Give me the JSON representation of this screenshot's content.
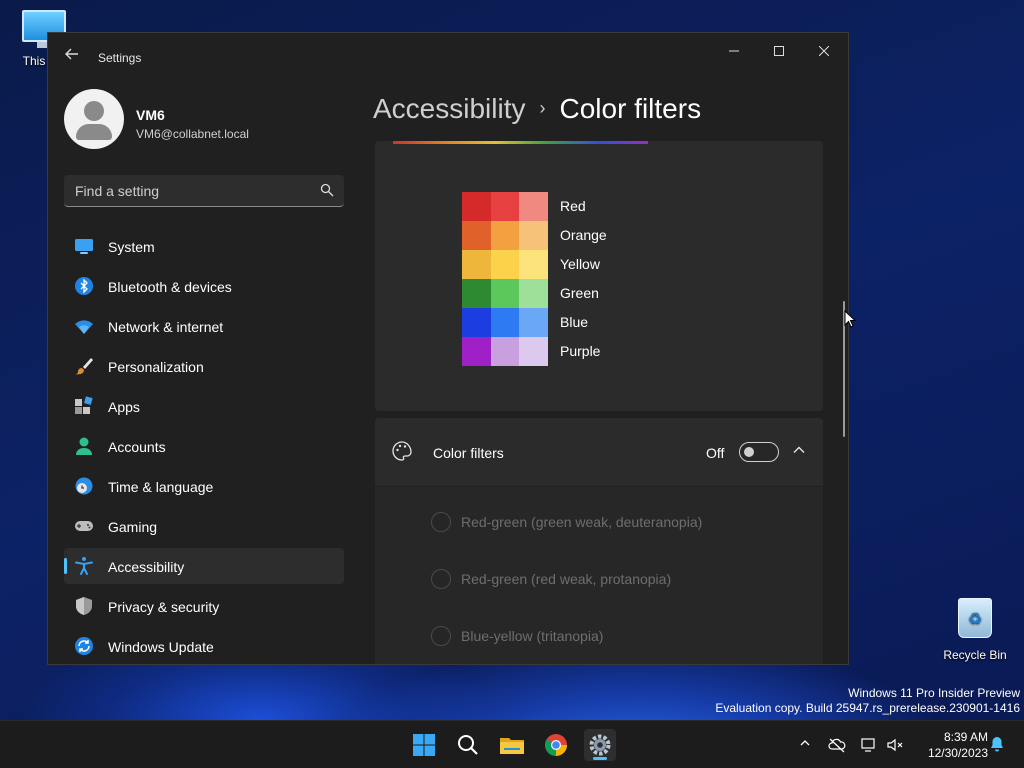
{
  "desktop": {
    "icons": [
      {
        "label": "This PC"
      },
      {
        "label": "Recycle Bin"
      }
    ],
    "watermark": {
      "line1": "Windows 11 Pro Insider Preview",
      "line2": "Evaluation copy. Build 25947.rs_prerelease.230901-1416"
    }
  },
  "window": {
    "app_title": "Settings",
    "controls": {
      "minimize": "–",
      "maximize": "□",
      "close": "✕"
    }
  },
  "profile": {
    "name": "VM6",
    "email": "VM6@collabnet.local"
  },
  "search": {
    "placeholder": "Find a setting"
  },
  "sidebar": {
    "items": [
      {
        "label": "System",
        "icon": "system-icon",
        "active": false
      },
      {
        "label": "Bluetooth & devices",
        "icon": "bluetooth-icon",
        "active": false
      },
      {
        "label": "Network & internet",
        "icon": "wifi-icon",
        "active": false
      },
      {
        "label": "Personalization",
        "icon": "brush-icon",
        "active": false
      },
      {
        "label": "Apps",
        "icon": "apps-icon",
        "active": false
      },
      {
        "label": "Accounts",
        "icon": "account-icon",
        "active": false
      },
      {
        "label": "Time & language",
        "icon": "globe-clock-icon",
        "active": false
      },
      {
        "label": "Gaming",
        "icon": "gamepad-icon",
        "active": false
      },
      {
        "label": "Accessibility",
        "icon": "accessibility-icon",
        "active": true
      },
      {
        "label": "Privacy & security",
        "icon": "shield-icon",
        "active": false
      },
      {
        "label": "Windows Update",
        "icon": "update-icon",
        "active": false
      }
    ]
  },
  "breadcrumb": {
    "parent": "Accessibility",
    "separator": "›",
    "current": "Color filters"
  },
  "color_preview": {
    "labels": [
      "Red",
      "Orange",
      "Yellow",
      "Green",
      "Blue",
      "Purple"
    ],
    "swatches": [
      [
        "#d42a2a",
        "#e64040",
        "#f08a80"
      ],
      [
        "#e0622a",
        "#f2a040",
        "#f6c27a"
      ],
      [
        "#eeb63a",
        "#fbd24a",
        "#fbe27a"
      ],
      [
        "#2e8a30",
        "#5cc85c",
        "#9ee09a"
      ],
      [
        "#1c3ee0",
        "#2e7af2",
        "#6aa8f6"
      ],
      [
        "#a020c8",
        "#c8a0e0",
        "#ddc8ee"
      ]
    ]
  },
  "color_filters": {
    "title": "Color filters",
    "toggle_state": "Off",
    "enabled": false,
    "options": [
      {
        "label": "Red-green (green weak, deuteranopia)",
        "selected": false
      },
      {
        "label": "Red-green (red weak, protanopia)",
        "selected": false
      },
      {
        "label": "Blue-yellow (tritanopia)",
        "selected": false
      }
    ]
  },
  "taskbar": {
    "apps": [
      "start-icon",
      "search-icon",
      "file-explorer-icon",
      "chrome-icon",
      "settings-icon"
    ],
    "active_app": "settings-icon",
    "clock": {
      "time": "8:39 AM",
      "date": "12/30/2023"
    }
  },
  "colors": {
    "accent": "#4cc2ff",
    "window_bg": "#202020",
    "card_bg": "#2b2b2b"
  }
}
